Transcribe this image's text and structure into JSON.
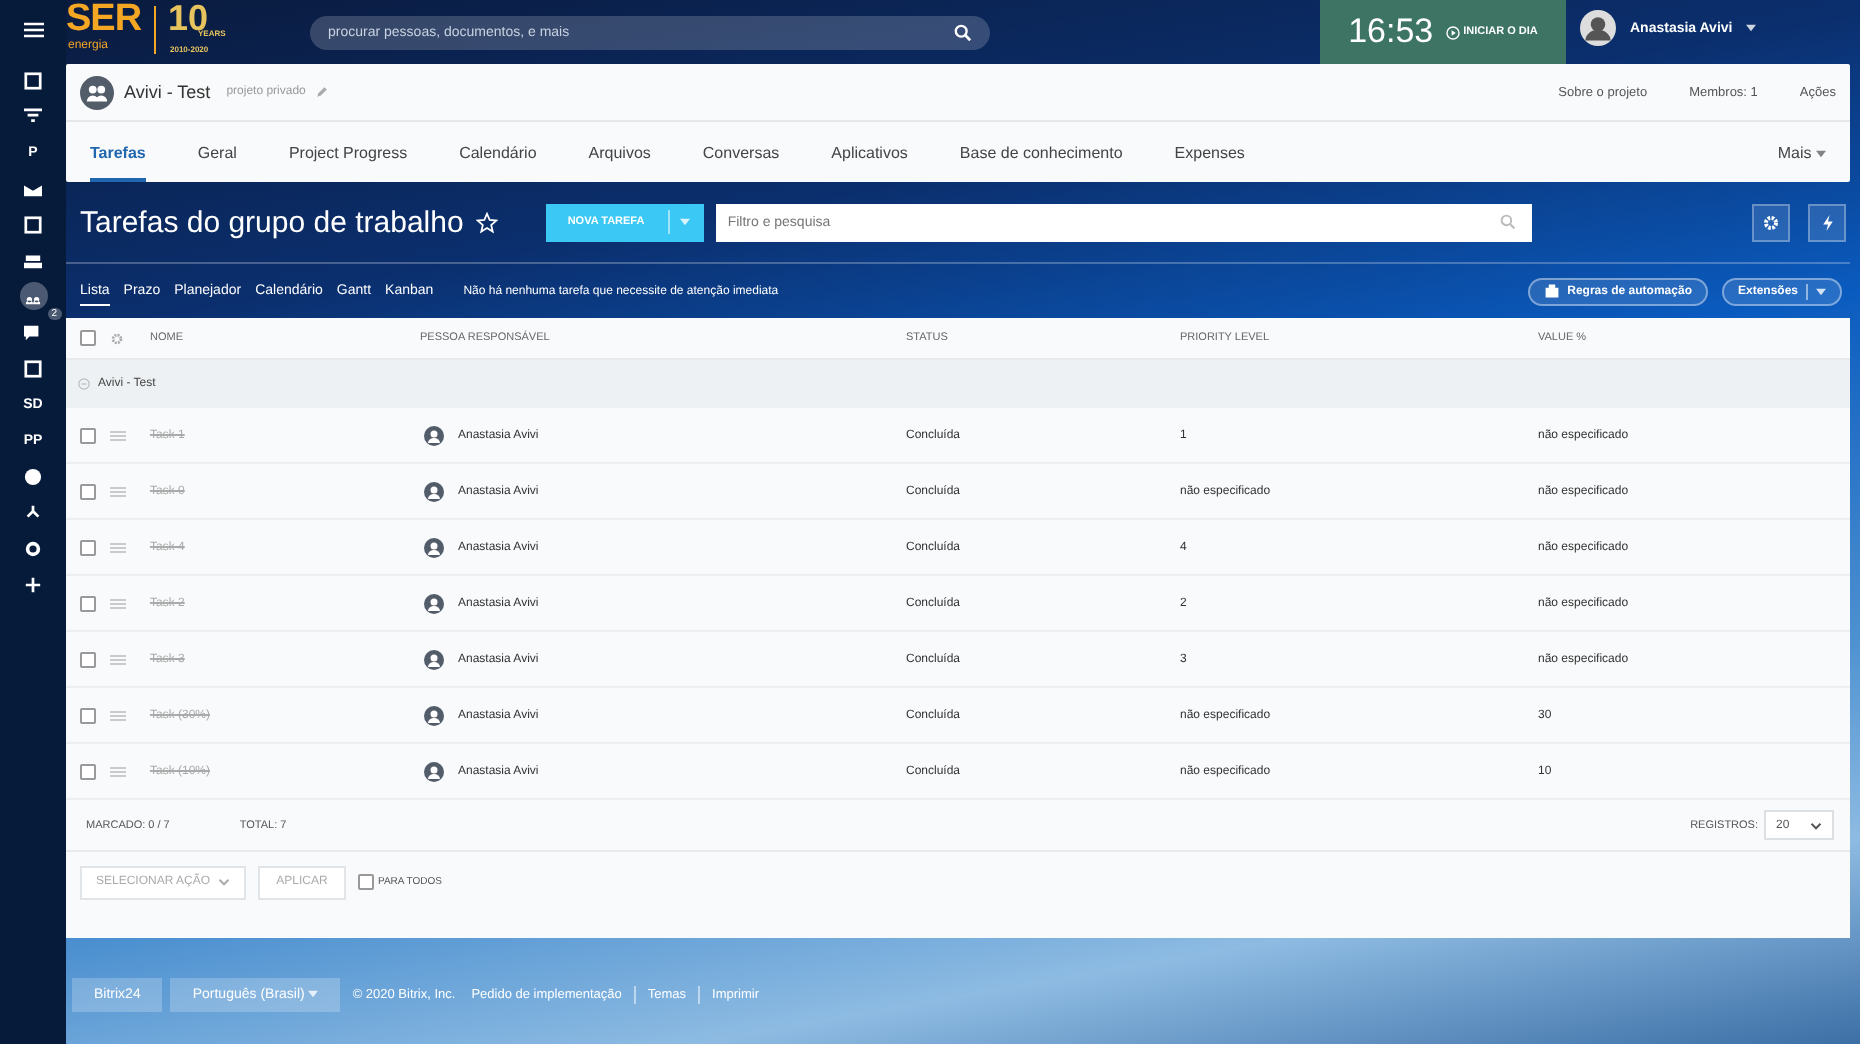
{
  "logo": {
    "brand": "SER",
    "tagline": "energia",
    "years_number": "10",
    "years_label": "YEARS",
    "years_range": "2010-2020"
  },
  "sidebar": {
    "items": [
      {
        "kind": "window"
      },
      {
        "kind": "filter"
      },
      {
        "kind": "text",
        "label": "P"
      },
      {
        "kind": "mail"
      },
      {
        "kind": "picture"
      },
      {
        "kind": "drive"
      },
      {
        "kind": "group",
        "selected": true
      },
      {
        "kind": "chat",
        "badge": "2"
      },
      {
        "kind": "calendar"
      },
      {
        "kind": "text",
        "label": "SD"
      },
      {
        "kind": "text",
        "label": "PP"
      },
      {
        "kind": "circle"
      },
      {
        "kind": "tree"
      },
      {
        "kind": "gear"
      },
      {
        "kind": "plus"
      }
    ]
  },
  "search": {
    "placeholder": "procurar pessoas, documentos, e mais"
  },
  "clock": {
    "time": "16:53",
    "action": "INICIAR O DIA"
  },
  "user": {
    "name": "Anastasia Avivi"
  },
  "project": {
    "name": "Avivi - Test",
    "privacy": "projeto privado",
    "links": [
      "Sobre o projeto",
      "Membros: 1",
      "Ações"
    ]
  },
  "tabs": [
    {
      "label": "Tarefas",
      "selected": true
    },
    {
      "label": "Geral",
      "selected": false
    },
    {
      "label": "Project Progress",
      "selected": false
    },
    {
      "label": "Calendário",
      "selected": false
    },
    {
      "label": "Arquivos",
      "selected": false
    },
    {
      "label": "Conversas",
      "selected": false
    },
    {
      "label": "Aplicativos",
      "selected": false
    },
    {
      "label": "Base de conhecimento",
      "selected": false
    },
    {
      "label": "Expenses",
      "selected": false
    }
  ],
  "more_tab": "Mais",
  "page_title": "Tarefas do grupo de trabalho",
  "new_task_button": "NOVA TAREFA",
  "filter": {
    "placeholder": "Filtro e pesquisa"
  },
  "views": [
    {
      "label": "Lista",
      "selected": true
    },
    {
      "label": "Prazo",
      "selected": false
    },
    {
      "label": "Planejador",
      "selected": false
    },
    {
      "label": "Calendário",
      "selected": false
    },
    {
      "label": "Gantt",
      "selected": false
    },
    {
      "label": "Kanban",
      "selected": false
    }
  ],
  "attention_message": "Não há nenhuma tarefa que necessite de atenção imediata",
  "automation_button": "Regras de automação",
  "extensions_button": "Extensões",
  "table": {
    "select_all_checked": false,
    "columns": [
      "NOME",
      "PESSOA RESPONSÁVEL",
      "STATUS",
      "PRIORITY LEVEL",
      "VALUE %"
    ],
    "group": "Avivi - Test",
    "rows": [
      {
        "checked": false,
        "name": "Task 1",
        "completed": true,
        "person": "Anastasia Avivi",
        "status": "Concluída",
        "priority": "1",
        "value": "não especificado"
      },
      {
        "checked": false,
        "name": "Task 0",
        "completed": true,
        "person": "Anastasia Avivi",
        "status": "Concluída",
        "priority": "não especificado",
        "value": "não especificado"
      },
      {
        "checked": false,
        "name": "Task 4",
        "completed": true,
        "person": "Anastasia Avivi",
        "status": "Concluída",
        "priority": "4",
        "value": "não especificado"
      },
      {
        "checked": false,
        "name": "Task 2",
        "completed": true,
        "person": "Anastasia Avivi",
        "status": "Concluída",
        "priority": "2",
        "value": "não especificado"
      },
      {
        "checked": false,
        "name": "Task 3",
        "completed": true,
        "person": "Anastasia Avivi",
        "status": "Concluída",
        "priority": "3",
        "value": "não especificado"
      },
      {
        "checked": false,
        "name": "Task (30%)",
        "completed": true,
        "person": "Anastasia Avivi",
        "status": "Concluída",
        "priority": "não especificado",
        "value": "30"
      },
      {
        "checked": false,
        "name": "Task (10%)",
        "completed": true,
        "person": "Anastasia Avivi",
        "status": "Concluída",
        "priority": "não especificado",
        "value": "10"
      }
    ],
    "marked": "MARCADO: 0 / 7",
    "total": "TOTAL: 7",
    "records_label": "REGISTROS:",
    "records_value": "20",
    "action_select": "SELECIONAR AÇÃO",
    "apply_button": "APLICAR",
    "for_all": {
      "label": "PARA TODOS",
      "checked": false
    }
  },
  "footer": {
    "brand_button": "Bitrix24",
    "language": "Português (Brasil)",
    "links": [
      "© 2020 Bitrix, Inc.",
      "Pedido de implementação",
      "Temas",
      "Imprimir"
    ]
  }
}
